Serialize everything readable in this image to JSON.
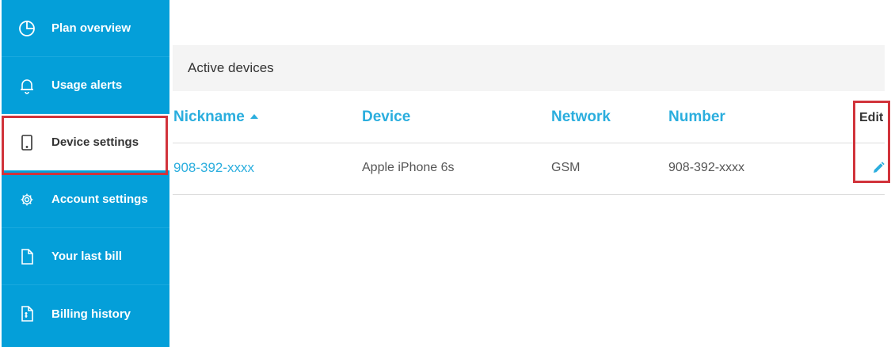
{
  "sidebar": {
    "items": [
      {
        "label": "Plan overview",
        "icon": "pie-chart-icon"
      },
      {
        "label": "Usage alerts",
        "icon": "bell-icon"
      },
      {
        "label": "Device settings",
        "icon": "phone-icon",
        "active": true
      },
      {
        "label": "Account settings",
        "icon": "gear-icon"
      },
      {
        "label": "Your last bill",
        "icon": "document-icon"
      },
      {
        "label": "Billing history",
        "icon": "receipt-icon"
      }
    ]
  },
  "panel": {
    "title": "Active devices"
  },
  "table": {
    "headers": {
      "nickname": "Nickname",
      "device": "Device",
      "network": "Network",
      "number": "Number",
      "edit": "Edit"
    },
    "sort": {
      "column": "nickname",
      "direction": "ascending"
    },
    "rows": [
      {
        "nickname": "908-392-xxxx",
        "device": "Apple iPhone 6s",
        "network": "GSM",
        "number": "908-392-xxxx"
      }
    ]
  },
  "colors": {
    "sidebar_bg": "#049fd9",
    "accent": "#2baede",
    "highlight_outline": "#d1333b",
    "header_bg": "#f4f4f4"
  }
}
